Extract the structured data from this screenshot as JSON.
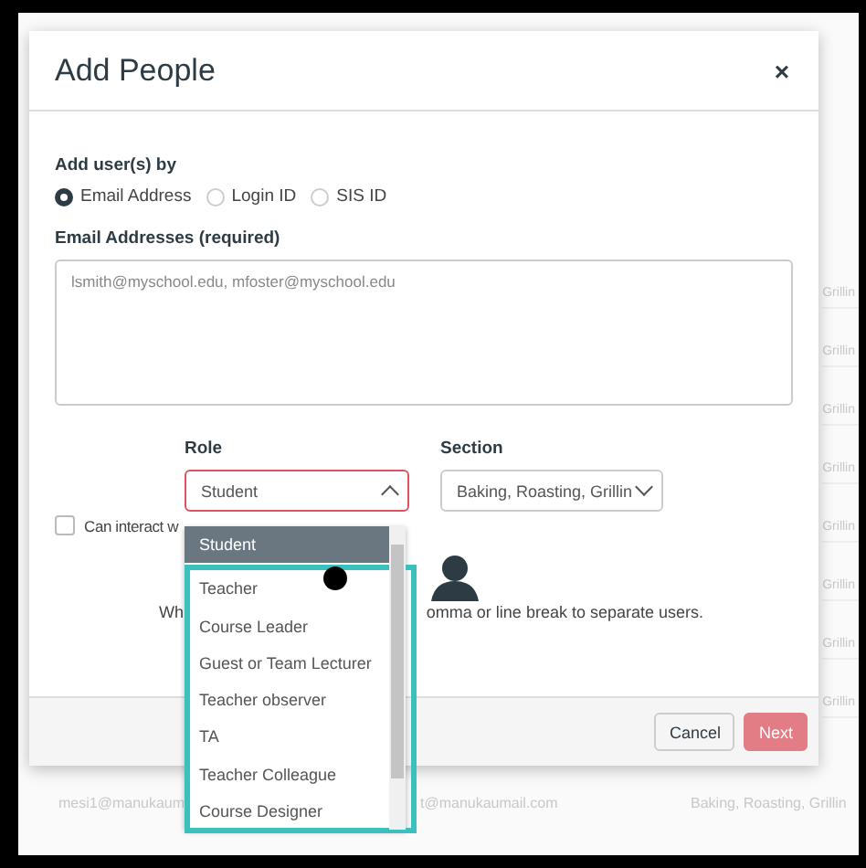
{
  "background": {
    "right_column": [
      "Grillin",
      "Grillin",
      "Grillin",
      "Grillin",
      "Grillin",
      "Grillin",
      "Grillin",
      "Grillin"
    ],
    "bottom_row": [
      "mesi1@manukaum",
      "t@manukaumail.com",
      "Baking, Roasting, Grillin"
    ]
  },
  "dialog": {
    "title": "Add People",
    "close": "×",
    "add_by": {
      "label": "Add user(s) by",
      "options": [
        {
          "label": "Email Address",
          "selected": true
        },
        {
          "label": "Login ID",
          "selected": false
        },
        {
          "label": "SIS ID",
          "selected": false
        }
      ]
    },
    "emails": {
      "label": "Email Addresses (required)",
      "placeholder": "lsmith@myschool.edu, mfoster@myschool.edu"
    },
    "role": {
      "label": "Role",
      "value": "Student",
      "expanded": true,
      "options": [
        {
          "label": "Student",
          "selected": true
        },
        {
          "label": "Teacher",
          "selected": false
        },
        {
          "label": "Course Leader",
          "selected": false
        },
        {
          "label": "Guest or Team Lecturer",
          "selected": false
        },
        {
          "label": "Teacher observer",
          "selected": false
        },
        {
          "label": "TA",
          "selected": false
        },
        {
          "label": "Teacher Colleague",
          "selected": false
        },
        {
          "label": "Course Designer",
          "selected": false
        }
      ]
    },
    "section": {
      "label": "Section",
      "value": "Baking, Roasting, Grillin"
    },
    "interact": {
      "label": "Can interact w",
      "checked": false
    },
    "hint": [
      "Wh",
      "omma or line break to separate users."
    ],
    "buttons": [
      {
        "label": "Cancel",
        "kind": "secondary"
      },
      {
        "label": "Next",
        "kind": "primary"
      }
    ]
  }
}
